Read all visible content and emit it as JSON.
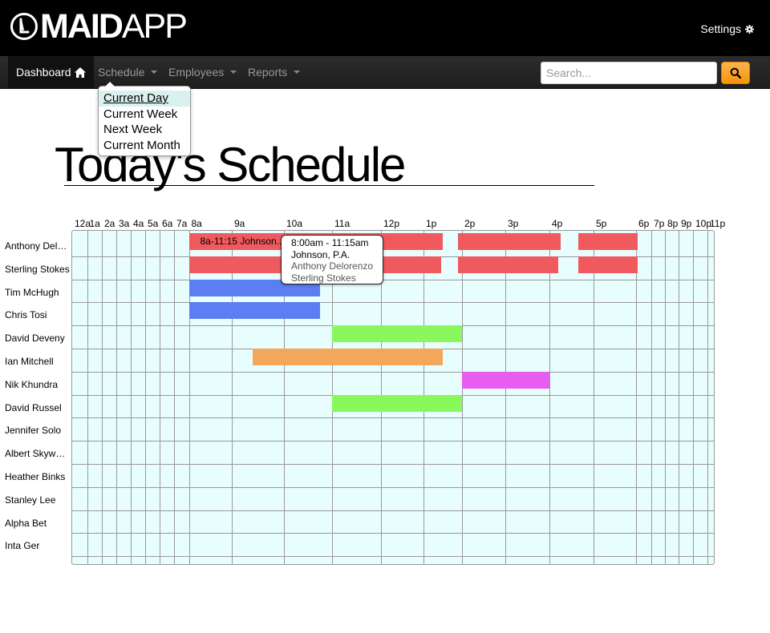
{
  "header": {
    "brand_bold": "MAID",
    "brand_light": "APP",
    "settings_label": "Settings",
    "settings_icon": "gear-icon"
  },
  "nav": {
    "dashboard_label": "Dashboard",
    "dashboard_icon": "home-icon",
    "schedule_label": "Schedule",
    "employees_label": "Employees",
    "reports_label": "Reports",
    "search_placeholder": "Search...",
    "search_icon": "search-icon",
    "accent_color": "#f89406"
  },
  "schedule_menu": {
    "items": [
      "Current Day",
      "Current Week",
      "Next Week",
      "Current Month"
    ],
    "selected": "Current Day"
  },
  "page": {
    "title": "Today's Schedule"
  },
  "grid": {
    "hours": [
      "12a",
      "1a",
      "2a",
      "3a",
      "4a",
      "5a",
      "6a",
      "7a",
      "8a",
      "9a",
      "10a",
      "11a",
      "12p",
      "1p",
      "2p",
      "3p",
      "4p",
      "5p",
      "6p",
      "7p",
      "8p",
      "9p",
      "10p",
      "11p"
    ],
    "employees": [
      "Anthony Delor...",
      "Sterling Stokes",
      "Tim McHugh",
      "Chris Tosi",
      "David Deveny",
      "Ian Mitchell",
      "Nik Khundra",
      "David Russel",
      "Jennifer Solo",
      "Albert Skywalk...",
      "Heather Binks",
      "Stanley Lee",
      "Alpha Bet",
      "Inta Ger"
    ],
    "shifts": [
      {
        "row": 0,
        "start": 8.0,
        "end": 11.25,
        "color": "#f05a5f",
        "label": "8a-11:15 Johnson..."
      },
      {
        "row": 0,
        "start": 11.25,
        "end": 13.5,
        "color": "#f05a5f",
        "label": ""
      },
      {
        "row": 0,
        "start": 13.9,
        "end": 16.25,
        "color": "#f05a5f",
        "label": ""
      },
      {
        "row": 0,
        "start": 16.65,
        "end": 18.1,
        "color": "#f05a5f",
        "label": ""
      },
      {
        "row": 1,
        "start": 8.0,
        "end": 11.25,
        "color": "#f05a5f",
        "label": ""
      },
      {
        "row": 1,
        "start": 11.25,
        "end": 13.45,
        "color": "#f05a5f",
        "label": ""
      },
      {
        "row": 1,
        "start": 13.9,
        "end": 16.2,
        "color": "#f05a5f",
        "label": ""
      },
      {
        "row": 1,
        "start": 16.65,
        "end": 18.1,
        "color": "#f05a5f",
        "label": ""
      },
      {
        "row": 2,
        "start": 8.0,
        "end": 10.75,
        "color": "#5b7ff2",
        "label": ""
      },
      {
        "row": 3,
        "start": 8.0,
        "end": 10.75,
        "color": "#5b7ff2",
        "label": ""
      },
      {
        "row": 4,
        "start": 11.0,
        "end": 14.0,
        "color": "#8af75c",
        "label": ""
      },
      {
        "row": 5,
        "start": 9.4,
        "end": 13.5,
        "color": "#f2a75c",
        "label": ""
      },
      {
        "row": 6,
        "start": 14.0,
        "end": 16.0,
        "color": "#e85cf2",
        "label": ""
      },
      {
        "row": 7,
        "start": 11.0,
        "end": 14.0,
        "color": "#8af75c",
        "label": ""
      }
    ]
  },
  "tooltip": {
    "time": "8:00am - 11:15am",
    "client": "Johnson, P.A.",
    "employee_1": "Anthony Delorenzo",
    "employee_2": "Sterling Stokes"
  }
}
